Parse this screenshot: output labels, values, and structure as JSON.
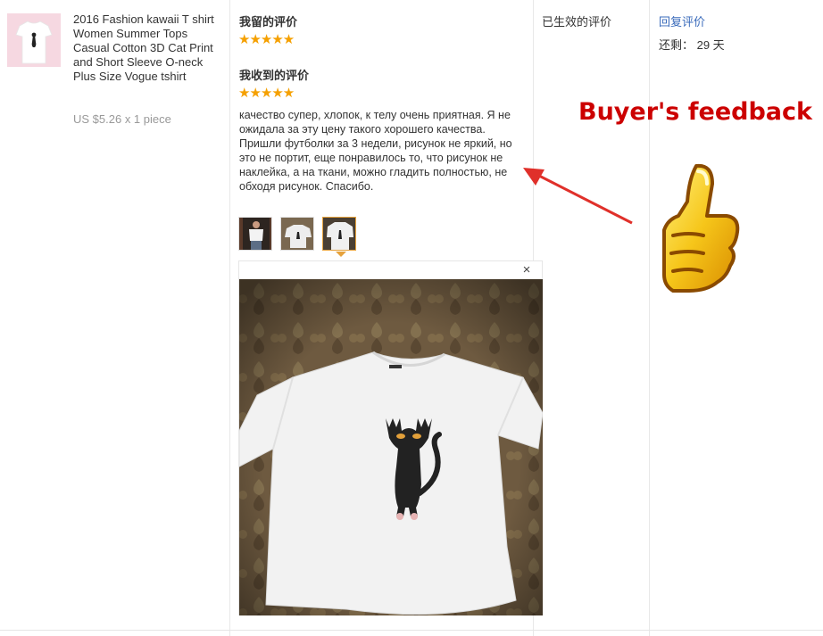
{
  "product": {
    "title": "2016 Fashion kawaii T shirt Women Summer Tops Casual Cotton 3D Cat Print and Short Sleeve O-neck Plus Size Vogue tshirt",
    "price": "US $5.26 x 1 piece"
  },
  "my_review": {
    "heading": "我留的评价",
    "stars": "★★★★★",
    "rating": 5
  },
  "received_review": {
    "heading": "我收到的评价",
    "stars": "★★★★★",
    "rating": 5,
    "text": "качество супер, хлопок, к телу очень приятная. Я не ожидала за эту цену такого хорошего качества. Пришли футболки за 3 недели, рисунок не яркий, но это не портит, еще понравилось то, что рисунок не наклейка, а на ткани, можно гладить полностью, не обходя рисунок. Спасибо.",
    "photo_count": 3,
    "active_photo": 3
  },
  "preview": {
    "close_label": "×"
  },
  "status": {
    "label": "已生效的评价"
  },
  "actions": {
    "reply_label": "回复评价",
    "remaining": "还剩： 29 天"
  },
  "annotation": {
    "label": "Buyer's feedback"
  },
  "colors": {
    "star": "#f5a000",
    "link": "#3a6bbb",
    "annotation": "#cc0000",
    "active_border": "#e6a23c"
  },
  "icons": {
    "close": "close-icon",
    "arrow": "arrow-icon",
    "thumbs_up": "thumbs-up-icon"
  }
}
